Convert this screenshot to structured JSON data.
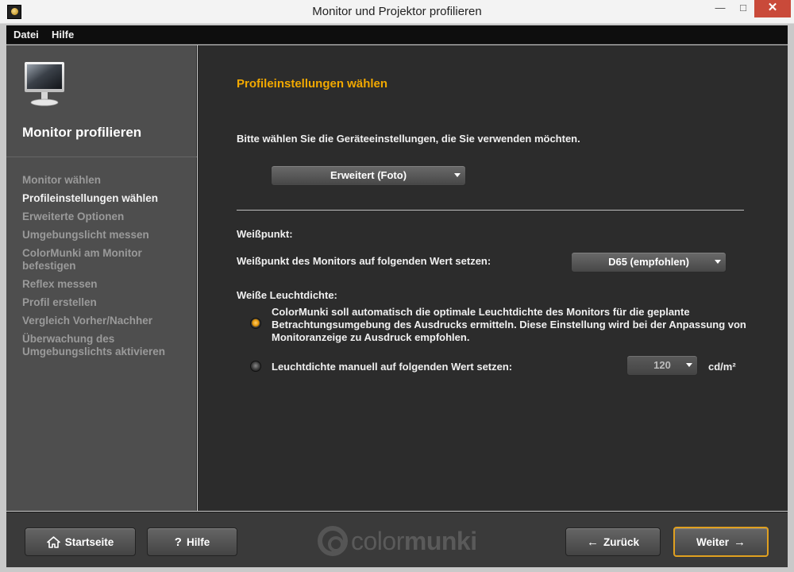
{
  "window": {
    "title": "Monitor und Projektor profilieren",
    "controls": {
      "minimize": "—",
      "maximize": "□",
      "close": "✕"
    }
  },
  "menu": {
    "items": [
      "Datei",
      "Hilfe"
    ]
  },
  "sidebar": {
    "icon": "monitor-icon",
    "title": "Monitor profilieren",
    "active_step": 1,
    "steps": [
      "Monitor wählen",
      "Profileinstellungen wählen",
      "Erweiterte Optionen",
      "Umgebungslicht messen",
      "ColorMunki am Monitor befestigen",
      "Reflex messen",
      "Profil erstellen",
      "Vergleich Vorher/Nachher",
      "Überwachung des Umgebungslichts aktivieren"
    ]
  },
  "main": {
    "title": "Profileinstellungen wählen",
    "instruction": "Bitte wählen Sie die Geräteeinstellungen, die Sie verwenden möchten.",
    "preset_dropdown": {
      "value": "Erweitert (Foto)"
    },
    "whitepoint": {
      "heading": "Weißpunkt:",
      "label": "Weißpunkt des Monitors auf folgenden Wert setzen:",
      "dropdown_value": "D65 (empfohlen)"
    },
    "luminance": {
      "heading": "Weiße Leuchtdichte:",
      "option_auto": "ColorMunki soll automatisch die optimale Leuchtdichte des Monitors für die geplante Betrachtungsumgebung des Ausdrucks ermitteln. Diese Einstellung wird bei der Anpassung von Monitoranzeige zu Ausdruck empfohlen.",
      "option_manual": "Leuchtdichte manuell auf folgenden Wert setzen:",
      "selected": "auto",
      "manual_value": "120",
      "unit": "cd/m²"
    }
  },
  "footer": {
    "home_label": "Startseite",
    "help_label": "Hilfe",
    "help_glyph": "?",
    "back_label": "Zurück",
    "back_glyph": "←",
    "next_label": "Weiter",
    "next_glyph": "→",
    "logo_light": "color",
    "logo_bold": "munki",
    "accent_color": "#e0a020"
  }
}
